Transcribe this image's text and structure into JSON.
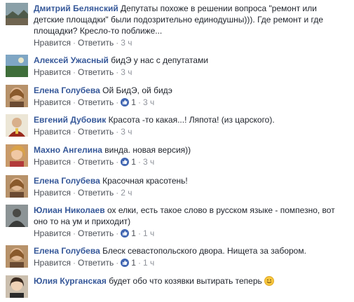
{
  "comments": [
    {
      "author": "Дмитрий Белянский",
      "text": "Депутаты похоже в решении вопроса \"ремонт или детские площадки\" были подозрительно единодушны))). Где ремонт и где площадки? Кресло-то поближе...",
      "like_label": "Нравится",
      "reply_label": "Ответить",
      "likes": "",
      "time": "3 ч",
      "avatar_icon": "avatar-landscape-icon"
    },
    {
      "author": "Алексей Ужасный",
      "text": "бидЭ у нас с депутатами",
      "like_label": "Нравится",
      "reply_label": "Ответить",
      "likes": "",
      "time": "3 ч",
      "avatar_icon": "avatar-landscape-icon"
    },
    {
      "author": "Елена Голубева",
      "text": "Ой БидЭ, ой бидэ",
      "like_label": "Нравится",
      "reply_label": "Ответить",
      "likes": "1",
      "time": "3 ч",
      "avatar_icon": "avatar-woman-icon"
    },
    {
      "author": "Евгений Дубовик",
      "text": "Красота -то какая...! Ляпота! (из царского).",
      "like_label": "Нравится",
      "reply_label": "Ответить",
      "likes": "",
      "time": "3 ч",
      "avatar_icon": "avatar-man-icon"
    },
    {
      "author": "Махно Ангелина",
      "text": "винда. новая версия))",
      "like_label": "Нравится",
      "reply_label": "Ответить",
      "likes": "1",
      "time": "3 ч",
      "avatar_icon": "avatar-woman-icon"
    },
    {
      "author": "Елена Голубева",
      "text": "Красочная красотень!",
      "like_label": "Нравится",
      "reply_label": "Ответить",
      "likes": "",
      "time": "2 ч",
      "avatar_icon": "avatar-woman-icon"
    },
    {
      "author": "Юлиан Николаев",
      "text": "ох елки, есть такое слово в русском языке - помпезно, вот оно то на ум и приходит)",
      "like_label": "Нравится",
      "reply_label": "Ответить",
      "likes": "1",
      "time": "1 ч",
      "avatar_icon": "avatar-man-icon"
    },
    {
      "author": "Елена Голубева",
      "text": "Блеск севастопольского двора. Нищета за забором.",
      "like_label": "Нравится",
      "reply_label": "Ответить",
      "likes": "1",
      "time": "1 ч",
      "avatar_icon": "avatar-woman-icon"
    },
    {
      "author": "Юлия Курганская",
      "text": "будет обо что козявки вытирать теперь",
      "like_label": "",
      "reply_label": "",
      "likes": "",
      "time": "",
      "avatar_icon": "avatar-woman-icon",
      "emoji": "smile-emoji-icon"
    }
  ],
  "colors": {
    "author": "#365899",
    "text": "#1d2129",
    "action": "#4b4f56",
    "time": "#90949c",
    "like_badge": "#4267b2"
  }
}
